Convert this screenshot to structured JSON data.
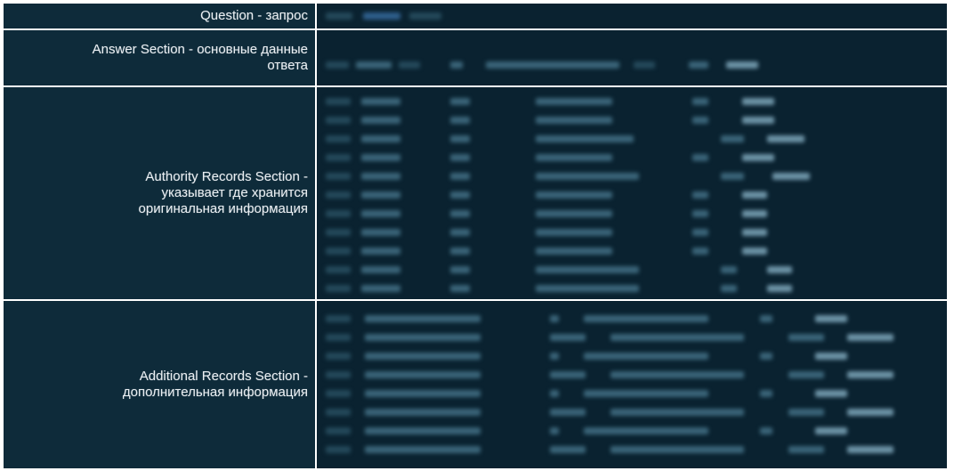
{
  "sections": [
    {
      "id": "question",
      "label_lines": [
        "Question - запрос"
      ]
    },
    {
      "id": "answer",
      "label_lines": [
        "Answer Section - основные данные",
        "ответа"
      ]
    },
    {
      "id": "authority",
      "label_lines": [
        "Authority Records Section -",
        "указывает где хранится",
        "оригинальная информация"
      ]
    },
    {
      "id": "additional",
      "label_lines": [
        "Additional Records Section -",
        "дополнительная информация"
      ]
    }
  ],
  "colors": {
    "label_bg": "#0e2b3a",
    "data_bg": "#0a2230",
    "text": "#e9eef2",
    "divider": "#ffffff"
  }
}
